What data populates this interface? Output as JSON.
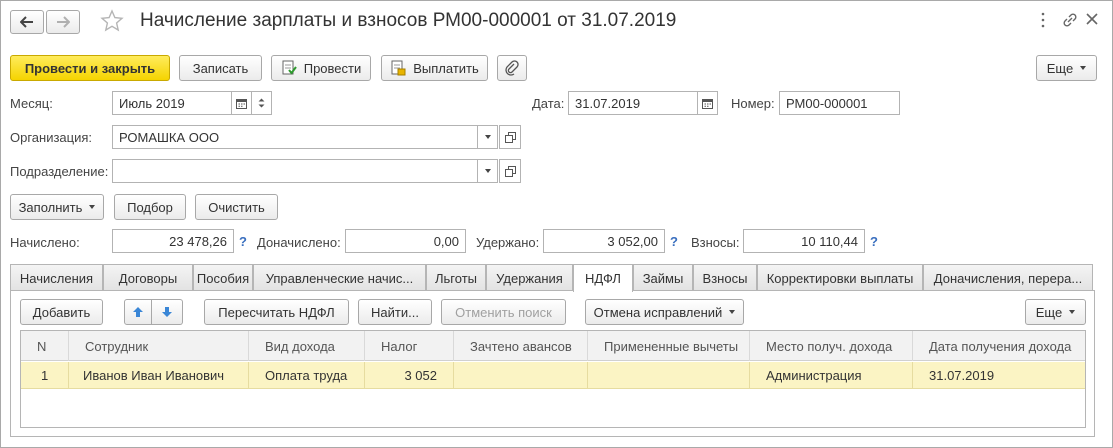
{
  "title": "Начисление зарплаты и взносов РМ00-000001 от 31.07.2019",
  "toolbar": {
    "post_close": "Провести и закрыть",
    "save": "Записать",
    "post": "Провести",
    "pay": "Выплатить",
    "more": "Еще"
  },
  "form": {
    "month_label": "Месяц:",
    "month_value": "Июль 2019",
    "date_label": "Дата:",
    "date_value": "31.07.2019",
    "number_label": "Номер:",
    "number_value": "РМ00-000001",
    "org_label": "Организация:",
    "org_value": "РОМАШКА ООО",
    "dept_label": "Подразделение:",
    "dept_value": ""
  },
  "actions": {
    "fill": "Заполнить",
    "select": "Подбор",
    "clear": "Очистить"
  },
  "totals": {
    "accrued_label": "Начислено:",
    "accrued_value": "23 478,26",
    "extra_label": "Доначислено:",
    "extra_value": "0,00",
    "withheld_label": "Удержано:",
    "withheld_value": "3 052,00",
    "contrib_label": "Взносы:",
    "contrib_value": "10 110,44",
    "help": "?"
  },
  "tabs": [
    "Начисления",
    "Договоры",
    "Пособия",
    "Управленческие начис...",
    "Льготы",
    "Удержания",
    "НДФЛ",
    "Займы",
    "Взносы",
    "Корректировки выплаты",
    "Доначисления, перера..."
  ],
  "active_tab": "НДФЛ",
  "tab_toolbar": {
    "add": "Добавить",
    "recalc": "Пересчитать НДФЛ",
    "find": "Найти...",
    "cancel_search": "Отменить поиск",
    "undo_fix": "Отмена исправлений",
    "more": "Еще"
  },
  "table": {
    "columns": [
      "N",
      "Сотрудник",
      "Вид дохода",
      "Налог",
      "Зачтено авансов",
      "Примененные вычеты",
      "Место получ. дохода",
      "Дата получения дохода"
    ],
    "rows": [
      [
        "1",
        "Иванов Иван Иванович",
        "Оплата труда",
        "3 052",
        "",
        "",
        "Администрация",
        "31.07.2019"
      ]
    ]
  },
  "colors": {
    "primary_button": "#f5d400",
    "selected_row": "#fbf4c4",
    "help_link": "#3a6fbf"
  }
}
